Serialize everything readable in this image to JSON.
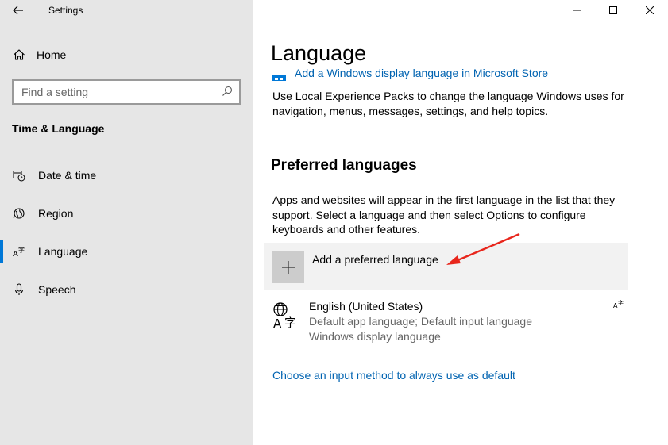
{
  "window": {
    "title": "Settings"
  },
  "sidebar": {
    "home_label": "Home",
    "search_placeholder": "Find a setting",
    "section_title": "Time & Language",
    "items": [
      {
        "label": "Date & time",
        "icon": "calendar-clock-icon"
      },
      {
        "label": "Region",
        "icon": "globe-icon"
      },
      {
        "label": "Language",
        "icon": "language-icon",
        "active": true
      },
      {
        "label": "Speech",
        "icon": "microphone-icon"
      }
    ]
  },
  "main": {
    "title": "Language",
    "store_link": "Add a Windows display language in Microsoft Store",
    "store_description": "Use Local Experience Packs to change the language Windows uses for navigation, menus, messages, settings, and help topics.",
    "preferred_heading": "Preferred languages",
    "preferred_description": "Apps and websites will appear in the first language in the list that they support. Select a language and then select Options to configure keyboards and other features.",
    "add_language_label": "Add a preferred language",
    "languages": [
      {
        "name": "English (United States)",
        "desc1": "Default app language; Default input language",
        "desc2": "Windows display language"
      }
    ],
    "input_method_link": "Choose an input method to always use as default"
  },
  "colors": {
    "accent": "#0078d7",
    "link": "#0063b1",
    "sidebar_bg": "#e6e6e6",
    "annotation_arrow": "#e8261c"
  }
}
